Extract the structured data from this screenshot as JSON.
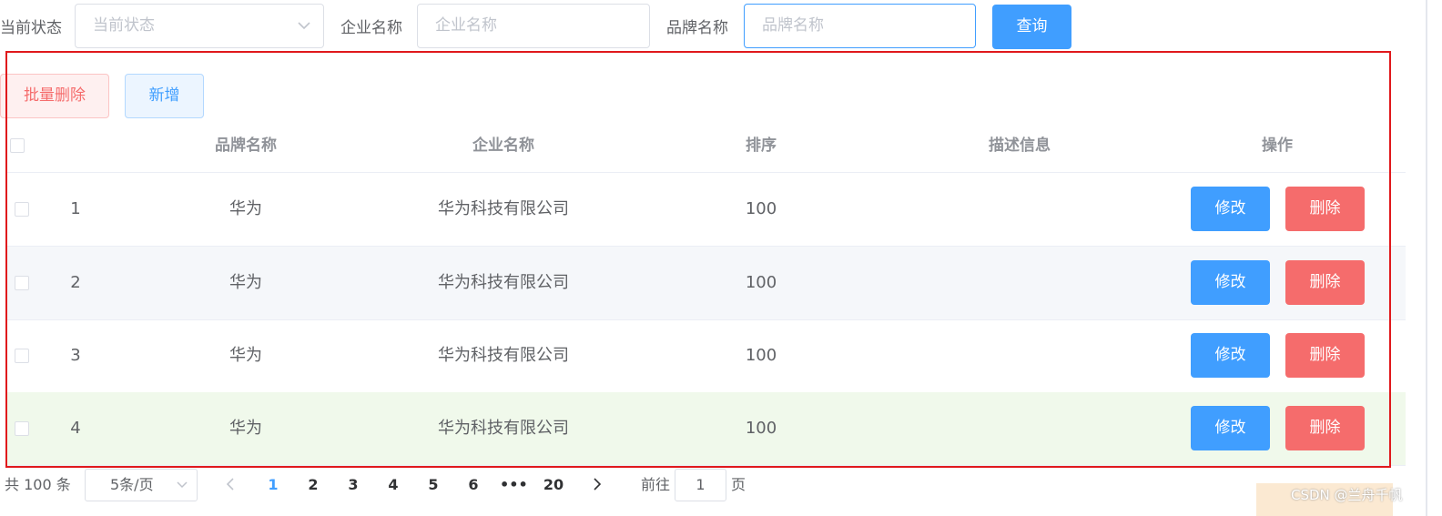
{
  "filters": {
    "status_label": "当前状态",
    "status_placeholder": "当前状态",
    "company_label": "企业名称",
    "company_placeholder": "企业名称",
    "brand_label": "品牌名称",
    "brand_placeholder": "品牌名称",
    "search_button": "查询"
  },
  "toolbar": {
    "batch_delete": "批量删除",
    "add": "新增"
  },
  "table": {
    "columns": [
      "品牌名称",
      "企业名称",
      "排序",
      "描述信息",
      "操作"
    ],
    "rows": [
      {
        "index": "1",
        "brand": "华为",
        "company": "华为科技有限公司",
        "order": "100",
        "desc": ""
      },
      {
        "index": "2",
        "brand": "华为",
        "company": "华为科技有限公司",
        "order": "100",
        "desc": ""
      },
      {
        "index": "3",
        "brand": "华为",
        "company": "华为科技有限公司",
        "order": "100",
        "desc": ""
      },
      {
        "index": "4",
        "brand": "华为",
        "company": "华为科技有限公司",
        "order": "100",
        "desc": ""
      }
    ],
    "edit_label": "修改",
    "delete_label": "删除"
  },
  "pagination": {
    "total": "共 100 条",
    "page_size": "5条/页",
    "pages": [
      "1",
      "2",
      "3",
      "4",
      "5",
      "6",
      "•••",
      "20"
    ],
    "current_page": "1",
    "goto_label": "前往",
    "goto_value": "1",
    "page_suffix": "页"
  },
  "watermark": "CSDN @兰舟千帆",
  "colors": {
    "primary": "#409eff",
    "danger": "#f56c6c",
    "highlight_frame": "#e0191c",
    "stripe": "#f5f7fa",
    "hover_row": "#f0f9eb"
  }
}
